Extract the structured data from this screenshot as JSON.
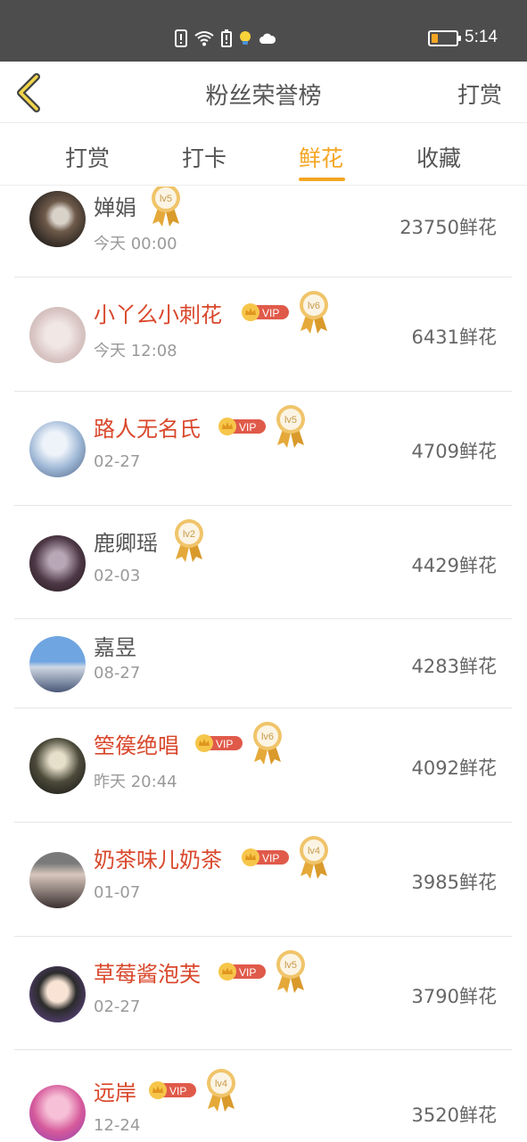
{
  "status_bar": {
    "time": "5:14",
    "battery_level": 0.25,
    "icons": [
      "alert-icon",
      "wifi-icon",
      "battery-saver-icon",
      "lightbulb-icon",
      "cloud-icon"
    ]
  },
  "header": {
    "title": "粉丝荣誉榜",
    "action_label": "打赏"
  },
  "tabs": [
    {
      "label": "打赏",
      "active": false
    },
    {
      "label": "打卡",
      "active": false
    },
    {
      "label": "鲜花",
      "active": true
    },
    {
      "label": "收藏",
      "active": false
    }
  ],
  "colors": {
    "accent": "#f5a623",
    "vip_name": "#d9472b",
    "status_bar": "#4d4d4d"
  },
  "vip_label": "VIP",
  "fans": [
    {
      "name": "婵娟",
      "date": "今天 00:00",
      "vip": false,
      "level": "lv5",
      "count": "23750鲜花"
    },
    {
      "name": "小丫么小刺花",
      "date": "今天 12:08",
      "vip": true,
      "level": "lv6",
      "count": "6431鲜花"
    },
    {
      "name": "路人无名氏",
      "date": "02-27",
      "vip": true,
      "level": "lv5",
      "count": "4709鲜花"
    },
    {
      "name": "鹿卿瑶",
      "date": "02-03",
      "vip": false,
      "level": "lv2",
      "count": "4429鲜花"
    },
    {
      "name": "嘉昱",
      "date": "08-27",
      "vip": false,
      "level": "",
      "count": "4283鲜花"
    },
    {
      "name": "箜篌绝唱",
      "date": "昨天 20:44",
      "vip": true,
      "level": "lv6",
      "count": "4092鲜花"
    },
    {
      "name": "奶茶味儿奶茶",
      "date": "01-07",
      "vip": true,
      "level": "lv4",
      "count": "3985鲜花"
    },
    {
      "name": "草莓酱泡芙",
      "date": "02-27",
      "vip": true,
      "level": "lv5",
      "count": "3790鲜花"
    },
    {
      "name": "远岸",
      "date": "12-24",
      "vip": true,
      "level": "lv4",
      "count": "3520鲜花"
    }
  ]
}
